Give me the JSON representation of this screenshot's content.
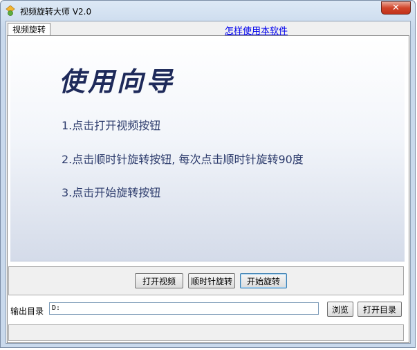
{
  "window": {
    "title": "视频旋转大师 V2.0",
    "close_label": "✕"
  },
  "tabs": [
    {
      "label": "视频旋转"
    }
  ],
  "help_link": "怎样使用本软件",
  "guide": {
    "title": "使用向导",
    "steps": [
      "1.点击打开视频按钮",
      "2.点击顺时针旋转按钮, 每次点击顺时针旋转90度",
      "3.点击开始旋转按钮"
    ]
  },
  "actions": {
    "open_video": "打开视频",
    "rotate_clockwise": "顺时针旋转",
    "start_rotate": "开始旋转"
  },
  "output": {
    "label": "输出目录",
    "value": "D:",
    "browse": "浏览",
    "open_dir": "打开目录"
  },
  "colors": {
    "guide_title": "#1e2a5a",
    "steps": "#2b3a6b",
    "link": "#0000ee",
    "close": "#c0321b"
  }
}
